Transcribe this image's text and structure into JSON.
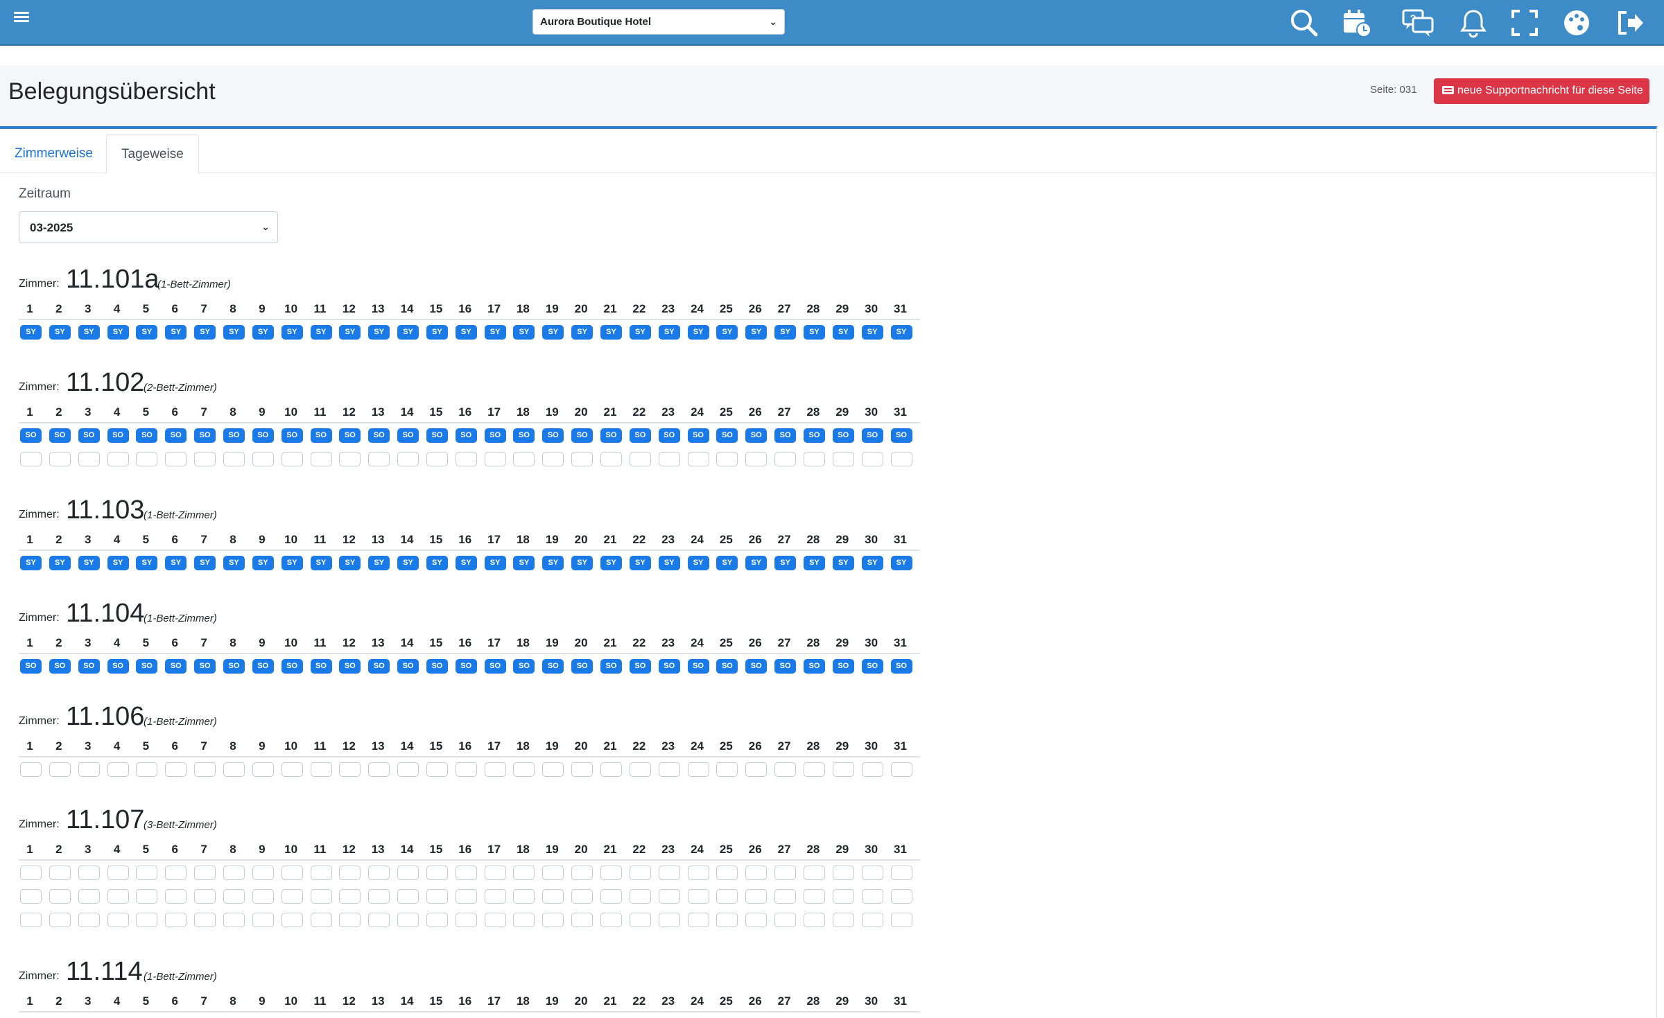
{
  "hotel_select": {
    "value": "Aurora Boutique Hotel"
  },
  "page": {
    "title": "Belegungsübersicht",
    "page_number": "Seite: 031",
    "support_button": "neue Supportnachricht für diese Seite"
  },
  "tabs": [
    {
      "label": "Zimmerweise",
      "active": false
    },
    {
      "label": "Tageweise",
      "active": true
    }
  ],
  "zeitraum": {
    "label": "Zeitraum",
    "value": "03-2025"
  },
  "zimmer_label": "Zimmer:",
  "days": [
    1,
    2,
    3,
    4,
    5,
    6,
    7,
    8,
    9,
    10,
    11,
    12,
    13,
    14,
    15,
    16,
    17,
    18,
    19,
    20,
    21,
    22,
    23,
    24,
    25,
    26,
    27,
    28,
    29,
    30,
    31
  ],
  "rooms": [
    {
      "number": "11.101a",
      "type": "(1-Bett-Zimmer)",
      "beds": [
        {
          "code": "SY"
        }
      ]
    },
    {
      "number": "11.102",
      "type": "(2-Bett-Zimmer)",
      "beds": [
        {
          "code": "SO"
        },
        {
          "code": ""
        }
      ]
    },
    {
      "number": "11.103",
      "type": "(1-Bett-Zimmer)",
      "beds": [
        {
          "code": "SY"
        }
      ]
    },
    {
      "number": "11.104",
      "type": "(1-Bett-Zimmer)",
      "beds": [
        {
          "code": "SO"
        }
      ]
    },
    {
      "number": "11.106",
      "type": "(1-Bett-Zimmer)",
      "beds": [
        {
          "code": ""
        }
      ]
    },
    {
      "number": "11.107",
      "type": "(3-Bett-Zimmer)",
      "beds": [
        {
          "code": ""
        },
        {
          "code": ""
        },
        {
          "code": ""
        }
      ]
    },
    {
      "number": "11.114",
      "type": "(1-Bett-Zimmer)",
      "beds": []
    }
  ],
  "colors": {
    "navbar": "#3d8bc7",
    "occupied": "#1a7be8",
    "support": "#dc3545",
    "tab_active": "#1a73d9"
  },
  "icons": [
    "menu-icon",
    "search-icon",
    "calendar-clock-icon",
    "chat-help-icon",
    "bell-icon",
    "fullscreen-icon",
    "palette-icon",
    "logout-icon"
  ]
}
